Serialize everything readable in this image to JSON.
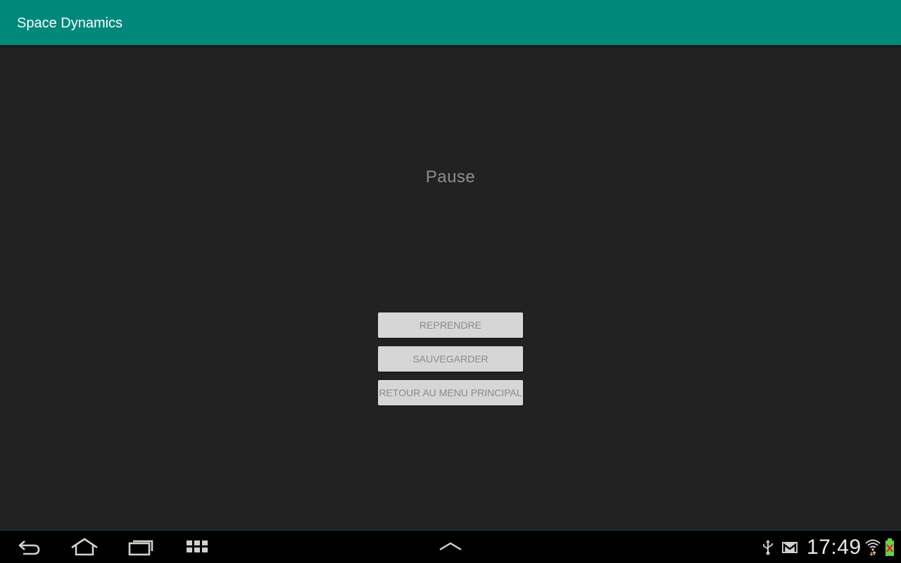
{
  "app_bar": {
    "title": "Space Dynamics",
    "color": "#00897b"
  },
  "pause_screen": {
    "title": "Pause",
    "buttons": {
      "resume": "REPRENDRE",
      "save": "SAUVEGARDER",
      "main_menu": "RETOUR AU MENU PRINCIPAL"
    }
  },
  "system_bar": {
    "nav_icons": [
      "back-icon",
      "home-icon",
      "recent-apps-icon",
      "app-grid-icon",
      "chevron-up-icon"
    ],
    "status_icons": [
      "usb-icon",
      "gmail-icon",
      "wifi-icon",
      "battery-icon"
    ],
    "clock": "17:49"
  }
}
